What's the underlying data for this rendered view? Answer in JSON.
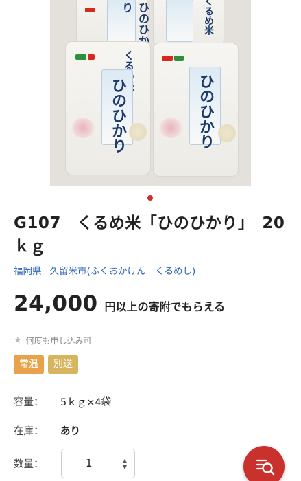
{
  "product": {
    "title": "G107　くるめ米「ひのひかり」　20ｋｇ",
    "region_label": "福岡県",
    "region_city": "久留米市(ふくおかけん　くるめし)",
    "price": "24,000",
    "price_suffix": "円以上の寄附でもらえる",
    "multi_apply": "何度も申し込み可",
    "tags": [
      {
        "label": "常温",
        "color": "#e8a24a"
      },
      {
        "label": "別送",
        "color": "#d7b55e"
      }
    ],
    "specs": {
      "capacity_label": "容量：",
      "capacity_value": "5ｋｇ×4袋",
      "stock_label": "在庫：",
      "stock_value": "あり",
      "quantity_label": "数量：",
      "quantity_value": "1"
    }
  },
  "gallery": {
    "bag_text_brand": "くるめ米",
    "bag_text_variety": "ひのひかり"
  },
  "colors": {
    "accent": "#c9322c",
    "link": "#2c63b5"
  },
  "icons": {
    "star": "star-icon",
    "search": "search-icon",
    "stepper": "updown-chevron-icon"
  }
}
